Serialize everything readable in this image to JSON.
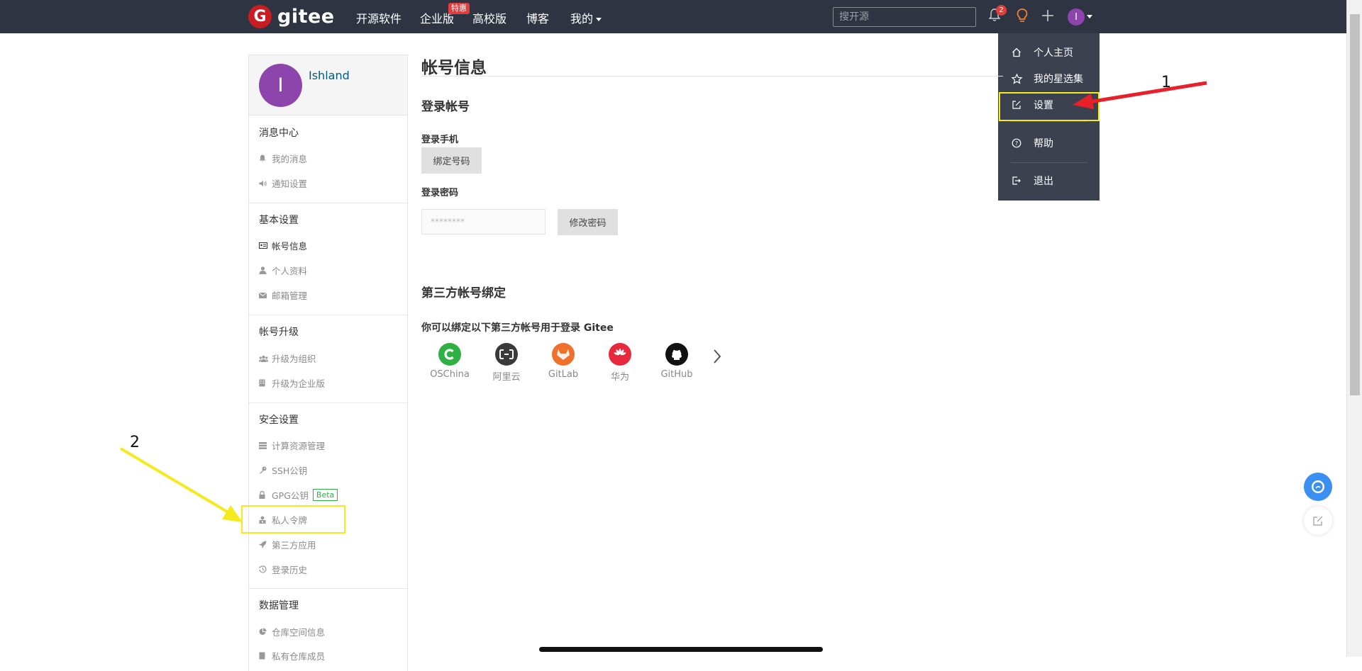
{
  "brand": {
    "logo_letter": "G",
    "name": "gitee"
  },
  "nav": {
    "items": [
      {
        "label": "开源软件"
      },
      {
        "label": "企业版"
      },
      {
        "label": "高校版"
      },
      {
        "label": "博客"
      },
      {
        "label": "我的"
      }
    ],
    "enterprise_badge": "特惠",
    "search_placeholder": "搜开源",
    "notification_count": "2",
    "avatar_letter": "I"
  },
  "user_menu": {
    "items": [
      {
        "label": "个人主页",
        "icon": "home-icon"
      },
      {
        "label": "我的星选集",
        "icon": "star-icon"
      },
      {
        "label": "设置",
        "icon": "edit-icon"
      },
      {
        "label": "帮助",
        "icon": "help-icon"
      },
      {
        "label": "退出",
        "icon": "logout-icon"
      }
    ]
  },
  "sidebar": {
    "avatar_letter": "I",
    "username": "Ishland",
    "sections": [
      {
        "title": "消息中心",
        "items": [
          "我的消息",
          "通知设置"
        ]
      },
      {
        "title": "基本设置",
        "items": [
          "帐号信息",
          "个人资料",
          "邮箱管理"
        ]
      },
      {
        "title": "帐号升级",
        "items": [
          "升级为组织",
          "升级为企业版"
        ]
      },
      {
        "title": "安全设置",
        "items": [
          "计算资源管理",
          "SSH公钥",
          "GPG公钥",
          "私人令牌",
          "第三方应用",
          "登录历史"
        ]
      },
      {
        "title": "数据管理",
        "items": [
          "仓库空间信息",
          "私有仓库成员"
        ]
      }
    ],
    "gpg_badge": "Beta"
  },
  "main": {
    "page_title": "帐号信息",
    "login_account_heading": "登录帐号",
    "phone_label": "登录手机",
    "bind_phone_button": "绑定号码",
    "password_label": "登录密码",
    "password_value": "********",
    "change_password_button": "修改密码",
    "third_party_heading": "第三方帐号绑定",
    "third_party_hint": "你可以绑定以下第三方帐号用于登录 Gitee",
    "providers": [
      {
        "name": "OSChina",
        "color": "#2eb043"
      },
      {
        "name": "阿里云",
        "color": "#3a3a3a"
      },
      {
        "name": "GitLab",
        "color": "#f0712c"
      },
      {
        "name": "华为",
        "color": "#e8283c"
      },
      {
        "name": "GitHub",
        "color": "#111111"
      }
    ]
  },
  "annotations": {
    "step1": "1",
    "step2": "2",
    "red": "#e8202a",
    "yellow": "#f5ea1e"
  }
}
